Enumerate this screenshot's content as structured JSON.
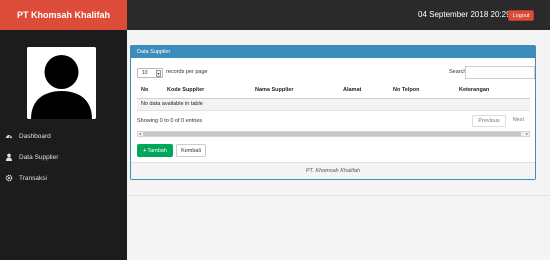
{
  "header": {
    "brand": "PT Khomsah Khalifah",
    "datetime": "04 September 2018 20:29",
    "logout_label": "Logout"
  },
  "sidebar": {
    "items": [
      {
        "label": "Dashboard",
        "icon": "dashboard-icon"
      },
      {
        "label": "Data Supplier",
        "icon": "user-icon"
      },
      {
        "label": "Transaksi",
        "icon": "gear-icon"
      }
    ]
  },
  "panel": {
    "title": "Data Supplier",
    "length_value": "10",
    "length_label": "records per page",
    "search_label": "Search:",
    "search_value": "",
    "columns": [
      "No",
      "Kode Supplier",
      "Nama Supplier",
      "Alamat",
      "No Telpon",
      "Keterangan"
    ],
    "empty_message": "No data available in table",
    "info": "Showing 0 to 0 of 0 entries",
    "previous_label": "Previous",
    "next_label": "Next",
    "tambah_label": "Tambah",
    "kembali_label": "Kembali",
    "footer": "PT. Khomsah Khalifah"
  },
  "colors": {
    "brand_red": "#dd4b39",
    "topbar": "#2a2a2a",
    "sidebar": "#1c1c1c",
    "panel_blue": "#3c8dbc",
    "success_green": "#00a65a"
  }
}
